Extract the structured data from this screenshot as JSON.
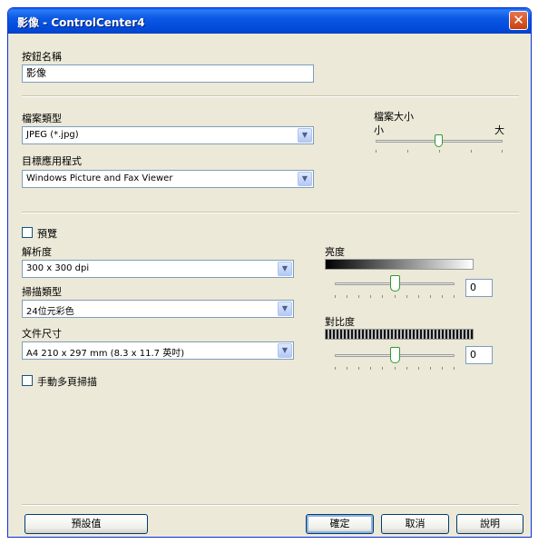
{
  "window": {
    "title": "影像 - ControlCenter4"
  },
  "button_name": {
    "label": "按鈕名稱",
    "value": "影像"
  },
  "file_type": {
    "label": "檔案類型",
    "selected": "JPEG (*.jpg)"
  },
  "file_size": {
    "label": "檔案大小",
    "small": "小",
    "large": "大",
    "level": 0.55
  },
  "target_app": {
    "label": "目標應用程式",
    "selected": "Windows Picture and Fax Viewer"
  },
  "preview": {
    "label": "預覽",
    "checked": false
  },
  "resolution": {
    "label": "解析度",
    "selected": "300 x 300 dpi"
  },
  "scan_type": {
    "label": "掃描類型",
    "selected": "24位元彩色"
  },
  "document_size": {
    "label": "文件尺寸",
    "selected": "A4 210 x 297 mm (8.3 x 11.7 英吋)"
  },
  "manual_multipage": {
    "label": "手動多頁掃描",
    "checked": false
  },
  "brightness": {
    "label": "亮度",
    "value": "0",
    "level": 0.5
  },
  "contrast": {
    "label": "對比度",
    "value": "0",
    "level": 0.5
  },
  "buttons": {
    "default": "預設值",
    "ok": "確定",
    "cancel": "取消",
    "help": "說明"
  },
  "icons": {
    "close": "close-icon",
    "dropdown": "chevron-down-icon"
  },
  "colors": {
    "titlebar": "#0054e3",
    "dialog_bg": "#ece9d8",
    "close_btn": "#d9541e",
    "thumb": "#2e9a2e"
  }
}
